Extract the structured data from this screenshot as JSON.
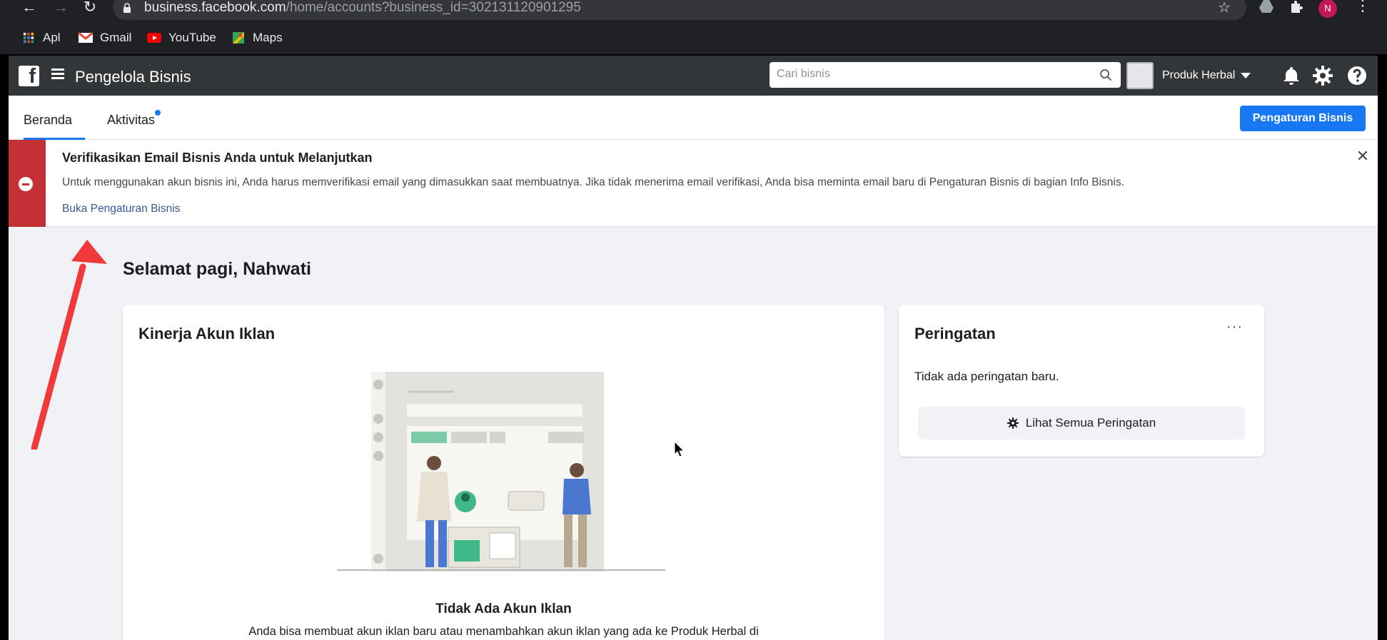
{
  "browser": {
    "url_host": "business.facebook.com",
    "url_path": "/home/accounts?business_id=302131120901295",
    "profile_initial": "N",
    "bookmarks": [
      {
        "label": "Apl",
        "icon": "apps-grid-icon"
      },
      {
        "label": "Gmail",
        "icon": "gmail-icon"
      },
      {
        "label": "YouTube",
        "icon": "youtube-icon"
      },
      {
        "label": "Maps",
        "icon": "maps-icon"
      }
    ]
  },
  "header": {
    "title": "Pengelola Bisnis",
    "search_placeholder": "Cari bisnis",
    "business_name": "Produk Herbal"
  },
  "tabs": [
    {
      "label": "Beranda",
      "active": true
    },
    {
      "label": "Aktivitas",
      "active": false,
      "has_dot": true
    }
  ],
  "settings_button": "Pengaturan Bisnis",
  "banner": {
    "title": "Verifikasikan Email Bisnis Anda untuk Melanjutkan",
    "text": "Untuk menggunakan akun bisnis ini, Anda harus memverifikasi email yang dimasukkan saat membuatnya. Jika tidak menerima email verifikasi, Anda bisa meminta email baru di Pengaturan Bisnis di bagian Info Bisnis.",
    "link": "Buka Pengaturan Bisnis"
  },
  "greeting": "Selamat pagi, Nahwati",
  "ads_card": {
    "title": "Kinerja Akun Iklan",
    "empty_title": "Tidak Ada Akun Iklan",
    "empty_text": "Anda bisa membuat akun iklan baru atau menambahkan akun iklan yang ada ke Produk Herbal di"
  },
  "alerts_card": {
    "title": "Peringatan",
    "more": "···",
    "empty_text": "Tidak ada peringatan baru.",
    "button": "Lihat Semua Peringatan"
  },
  "colors": {
    "accent_blue": "#1877f2",
    "banner_red": "#c43134",
    "link": "#385898",
    "annotation_arrow": "#f03a3a"
  }
}
